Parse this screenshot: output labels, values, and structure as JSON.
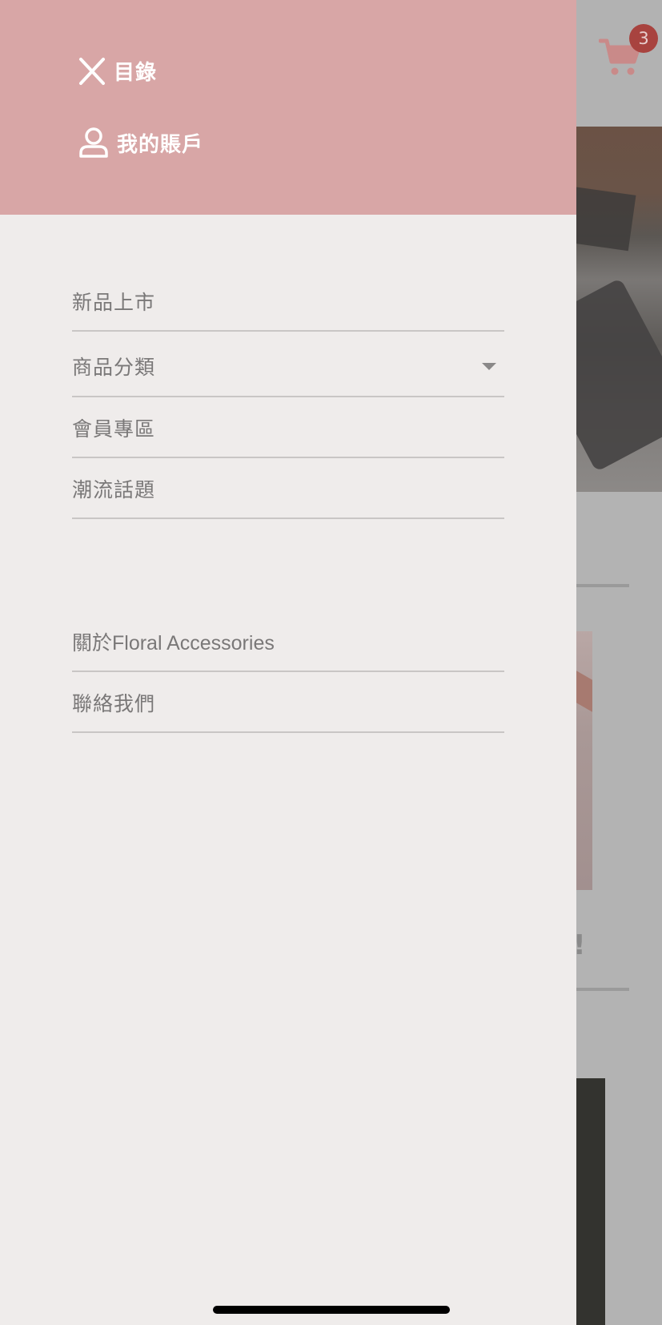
{
  "drawer": {
    "header": {
      "close_label": "目錄",
      "account_label": "我的賬戶"
    },
    "primary_items": [
      {
        "label": "新品上市",
        "has_dropdown": false
      },
      {
        "label": "商品分類",
        "has_dropdown": true
      },
      {
        "label": "會員專區",
        "has_dropdown": false
      },
      {
        "label": "潮流話題",
        "has_dropdown": false
      }
    ],
    "secondary_items": [
      {
        "label": "關於Floral Accessories"
      },
      {
        "label": "聯絡我們"
      }
    ]
  },
  "background_page": {
    "cart_count": "3"
  },
  "colors": {
    "drawer_header": "#d8a6a6",
    "drawer_bg": "#efeceb",
    "badge": "#a8433f",
    "cart_icon": "#c98a89"
  },
  "icons": {
    "close": "close-icon",
    "account": "user-icon",
    "cart": "cart-icon",
    "dropdown": "chevron-down-icon"
  }
}
